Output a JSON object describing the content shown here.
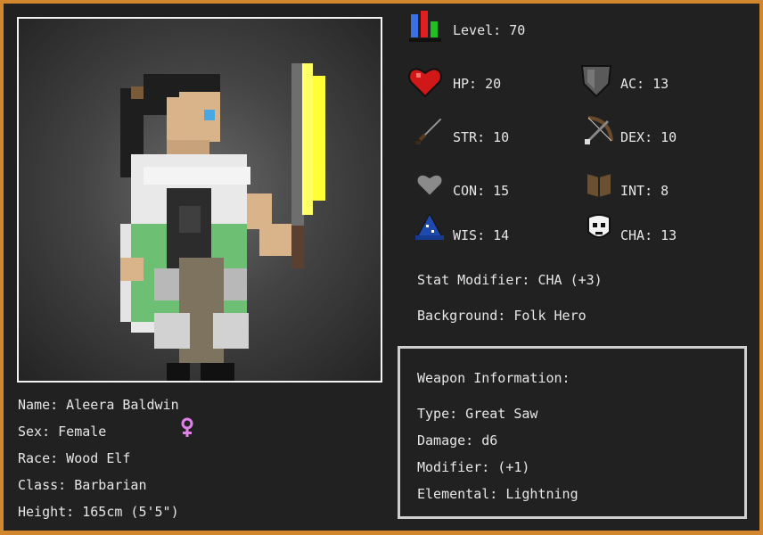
{
  "stats": {
    "level": "Level: 70",
    "hp": "HP: 20",
    "ac": "AC: 13",
    "str": "STR: 10",
    "dex": "DEX: 10",
    "con": "CON: 15",
    "int": "INT: 8",
    "wis": "WIS: 14",
    "cha": "CHA: 13",
    "stat_modifier": "Stat Modifier: CHA (+3)",
    "background": "Background: Folk Hero"
  },
  "character": {
    "name": "Name: Aleera Baldwin",
    "sex": "Sex: Female",
    "race": "Race: Wood Elf",
    "class": "Class: Barbarian",
    "height": "Height: 165cm (5'5\")"
  },
  "weapon": {
    "heading": "Weapon Information:",
    "type": "Type: Great Saw",
    "damage": "Damage: d6",
    "modifier": "Modifier: (+1)",
    "elemental": "Elemental: Lightning"
  },
  "icons": {
    "level": "level-bars-icon",
    "hp": "heart-icon",
    "ac": "shield-icon",
    "str": "sword-icon",
    "dex": "bow-icon",
    "con": "grey-heart-icon",
    "int": "book-icon",
    "wis": "wizard-hat-icon",
    "cha": "mask-icon",
    "sex": "female-symbol-icon"
  },
  "colors": {
    "frame": "#d2872f",
    "panel": "#212121",
    "text": "#e6e6e6",
    "female_symbol": "#e080e8"
  }
}
